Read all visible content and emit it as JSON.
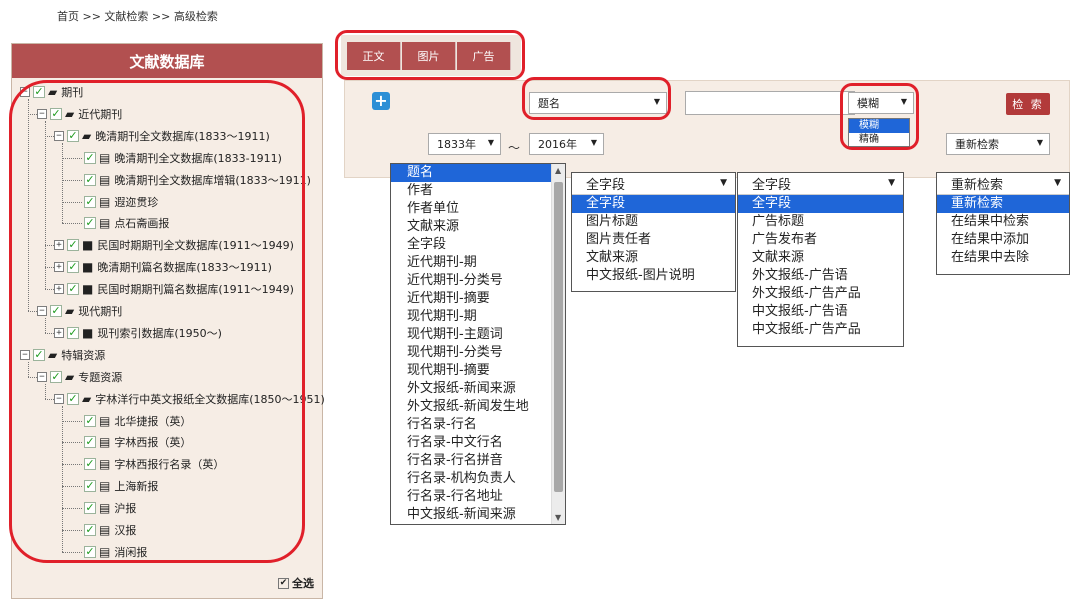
{
  "breadcrumb": "首页 >> 文献检索 >> 高级检索",
  "left_panel": {
    "title": "文献数据库",
    "tree": [
      {
        "label": "期刊",
        "level": 0,
        "toggle": "-",
        "icon": "folder-open-icon"
      },
      {
        "label": "近代期刊",
        "level": 1,
        "toggle": "-",
        "icon": "folder-open-icon"
      },
      {
        "label": "晚清期刊全文数据库(1833～1911)",
        "level": 2,
        "toggle": "-",
        "icon": "folder-open-icon"
      },
      {
        "label": "晚清期刊全文数据库(1833-1911)",
        "level": 3,
        "toggle": "",
        "icon": "document-icon"
      },
      {
        "label": "晚清期刊全文数据库增辑(1833～1911)",
        "level": 3,
        "toggle": "",
        "icon": "document-icon"
      },
      {
        "label": "遐迩贯珍",
        "level": 3,
        "toggle": "",
        "icon": "document-icon"
      },
      {
        "label": "点石斋画报",
        "level": 3,
        "toggle": "",
        "icon": "document-icon"
      },
      {
        "label": "民国时期期刊全文数据库(1911～1949)",
        "level": 2,
        "toggle": "+",
        "icon": "folder-closed-icon"
      },
      {
        "label": "晚清期刊篇名数据库(1833～1911)",
        "level": 2,
        "toggle": "+",
        "icon": "folder-closed-icon"
      },
      {
        "label": "民国时期期刊篇名数据库(1911～1949)",
        "level": 2,
        "toggle": "+",
        "icon": "folder-closed-icon"
      },
      {
        "label": "现代期刊",
        "level": 1,
        "toggle": "-",
        "icon": "folder-open-icon"
      },
      {
        "label": "现刊索引数据库(1950～)",
        "level": 2,
        "toggle": "+",
        "icon": "folder-closed-icon"
      },
      {
        "label": "特辑资源",
        "level": 0,
        "toggle": "-",
        "icon": "folder-open-icon"
      },
      {
        "label": "专题资源",
        "level": 1,
        "toggle": "-",
        "icon": "folder-open-icon"
      },
      {
        "label": "字林洋行中英文报纸全文数据库(1850～1951)",
        "level": 2,
        "toggle": "-",
        "icon": "folder-open-icon"
      },
      {
        "label": "北华捷报（英）",
        "level": 3,
        "toggle": "",
        "icon": "document-icon"
      },
      {
        "label": "字林西报（英）",
        "level": 3,
        "toggle": "",
        "icon": "document-icon"
      },
      {
        "label": "字林西报行名录（英）",
        "level": 3,
        "toggle": "",
        "icon": "document-icon"
      },
      {
        "label": "上海新报",
        "level": 3,
        "toggle": "",
        "icon": "document-icon"
      },
      {
        "label": "沪报",
        "level": 3,
        "toggle": "",
        "icon": "document-icon"
      },
      {
        "label": "汉报",
        "level": 3,
        "toggle": "",
        "icon": "document-icon"
      },
      {
        "label": "消闲报",
        "level": 3,
        "toggle": "",
        "icon": "document-icon"
      }
    ],
    "select_all": "全选"
  },
  "tabs": [
    "正文",
    "图片",
    "广告"
  ],
  "search": {
    "field_select": "题名",
    "keyword_value": "",
    "match_select": "模糊",
    "match_options": [
      "模糊",
      "精确"
    ],
    "search_button": "检 索",
    "year_start": "1833年",
    "year_end": "2016年",
    "tilde": "～",
    "scope_select": "重新检索"
  },
  "field_dropdown": {
    "items": [
      "题名",
      "作者",
      "作者单位",
      "文献来源",
      "全字段",
      "近代期刊-期",
      "近代期刊-分类号",
      "近代期刊-摘要",
      "现代期刊-期",
      "现代期刊-主题词",
      "现代期刊-分类号",
      "现代期刊-摘要",
      "外文报纸-新闻来源",
      "外文报纸-新闻发生地",
      "行名录-行名",
      "行名录-中文行名",
      "行名录-行名拼音",
      "行名录-机构负责人",
      "行名录-行名地址",
      "中文报纸-新闻来源"
    ]
  },
  "image_dropdown": {
    "header": "全字段",
    "items": [
      "全字段",
      "图片标题",
      "图片责任者",
      "文献来源",
      "中文报纸-图片说明"
    ]
  },
  "ad_dropdown": {
    "header": "全字段",
    "items": [
      "全字段",
      "广告标题",
      "广告发布者",
      "文献来源",
      "外文报纸-广告语",
      "外文报纸-广告产品",
      "中文报纸-广告语",
      "中文报纸-广告产品"
    ]
  },
  "scope_dropdown": {
    "header": "重新检索",
    "items": [
      "重新检索",
      "在结果中检索",
      "在结果中添加",
      "在结果中去除"
    ]
  },
  "colors": {
    "brand": "#b25050",
    "highlight": "#1f66d8",
    "annotation": "#e0202a",
    "check": "#1e9b1e"
  }
}
